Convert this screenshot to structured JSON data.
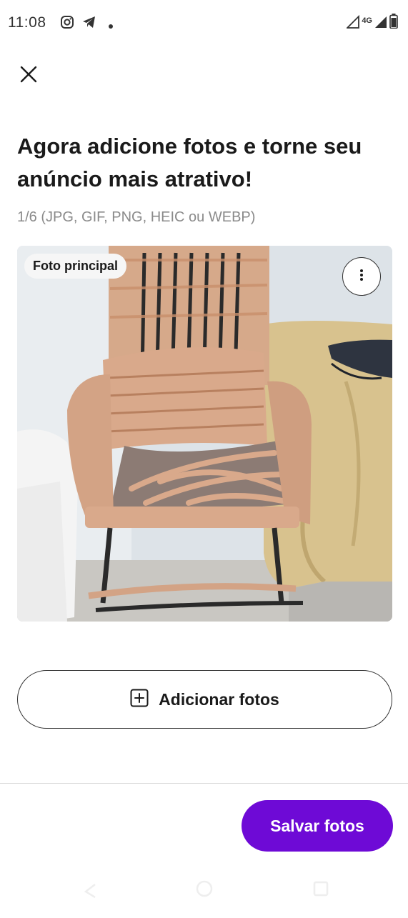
{
  "status_bar": {
    "time": "11:08",
    "network": "4G",
    "icons": [
      "instagram-icon",
      "telegram-icon",
      "notification-dot-icon",
      "signal-icon",
      "battery-icon"
    ]
  },
  "header": {
    "close_icon": "close-icon"
  },
  "title": "Agora adicione fotos e torne seu anúncio mais atrativo!",
  "subtitle": "1/6 (JPG, GIF, PNG, HEIC ou WEBP)",
  "photo": {
    "badge": "Foto principal",
    "menu_icon": "more-vertical-icon"
  },
  "add_photos": {
    "label": "Adicionar fotos",
    "icon": "plus-square-icon"
  },
  "save_photos": {
    "label": "Salvar fotos"
  },
  "colors": {
    "primary": "#6e0ad6",
    "text": "#1a1a1a",
    "subtitle": "#8a8a8a",
    "border": "#333333"
  }
}
